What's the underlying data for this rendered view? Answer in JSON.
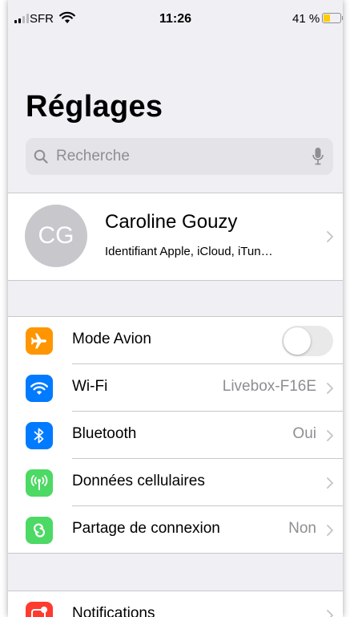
{
  "status_bar": {
    "carrier": "SFR",
    "time": "11:26",
    "battery_percent": "41 %",
    "battery_level": 0.41,
    "signal_bars": 2
  },
  "page": {
    "title": "Réglages"
  },
  "search": {
    "placeholder": "Recherche"
  },
  "profile": {
    "initials": "CG",
    "name": "Caroline Gouzy",
    "subtitle": "Identifiant Apple, iCloud, iTun…"
  },
  "settings": {
    "airplane": {
      "label": "Mode Avion",
      "toggle_on": false,
      "color": "#ff9500",
      "icon": "airplane-icon"
    },
    "wifi": {
      "label": "Wi-Fi",
      "value": "Livebox-F16E",
      "color": "#007aff",
      "icon": "wifi-icon"
    },
    "bluetooth": {
      "label": "Bluetooth",
      "value": "Oui",
      "color": "#007aff",
      "icon": "bluetooth-icon"
    },
    "cellular": {
      "label": "Données cellulaires",
      "color": "#4cd964",
      "icon": "antenna-icon"
    },
    "hotspot": {
      "label": "Partage de connexion",
      "value": "Non",
      "color": "#4cd964",
      "icon": "link-icon"
    },
    "notifications": {
      "label": "Notifications",
      "color": "#ff3b30",
      "icon": "notifications-icon"
    }
  }
}
